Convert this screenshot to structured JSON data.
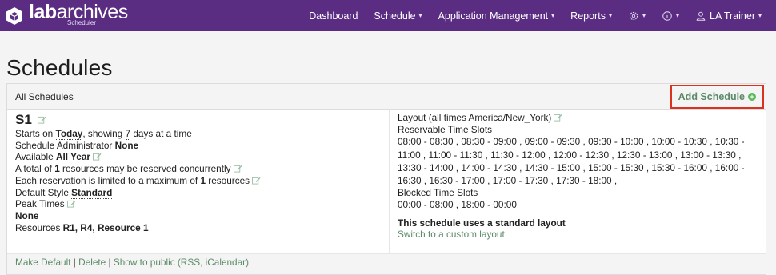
{
  "brand": {
    "name_bold": "lab",
    "name_rest": "archives",
    "subtitle": "Scheduler"
  },
  "nav": {
    "dashboard": "Dashboard",
    "schedule": "Schedule",
    "app_mgmt": "Application Management",
    "reports": "Reports",
    "user": "LA Trainer",
    "caret": "▾"
  },
  "page": {
    "title": "Schedules"
  },
  "panel": {
    "header_label": "All Schedules",
    "add_button": "Add Schedule",
    "add_icon": "+"
  },
  "schedule": {
    "name": "S1",
    "starts_prefix": "Starts on ",
    "starts_value": "Today",
    "showing_prefix": ", showing ",
    "days_value": "7",
    "days_suffix": " days at a time",
    "admin_prefix": "Schedule Administrator ",
    "admin_value": "None",
    "available_prefix": "Available ",
    "available_value": "All Year",
    "concurrent_prefix": "A total of ",
    "concurrent_value": "1",
    "concurrent_suffix": " resources may be reserved concurrently",
    "limit_prefix": "Each reservation is limited to a maximum of ",
    "limit_value": "1",
    "limit_suffix": " resources",
    "style_prefix": "Default Style ",
    "style_value": "Standard",
    "peak_label": "Peak Times",
    "peak_value": "None",
    "resources_prefix": "Resources ",
    "resources_value": "R1, R4, Resource 1"
  },
  "layout": {
    "heading": "Layout (all times America/New_York)",
    "reservable_label": "Reservable Time Slots",
    "reservable_slots": "08:00 - 08:30 , 08:30 - 09:00 , 09:00 - 09:30 , 09:30 - 10:00 , 10:00 - 10:30 , 10:30 - 11:00 , 11:00 - 11:30 , 11:30 - 12:00 , 12:00 - 12:30 , 12:30 - 13:00 , 13:00 - 13:30 , 13:30 - 14:00 , 14:00 - 14:30 , 14:30 - 15:00 , 15:00 - 15:30 , 15:30 - 16:00 , 16:00 - 16:30 , 16:30 - 17:00 , 17:00 - 17:30 , 17:30 - 18:00 ,",
    "blocked_label": "Blocked Time Slots",
    "blocked_slots": "00:00 - 08:00 , 18:00 - 00:00",
    "standard_note": "This schedule uses a standard layout",
    "switch_link": "Switch to a custom layout"
  },
  "footer": {
    "make_default": "Make Default",
    "separator": " | ",
    "delete": "Delete",
    "show_public": "Show to public (RSS, iCalendar)"
  },
  "colors": {
    "navbar": "#5a2d82",
    "link": "#5a8a67",
    "highlight": "#d9331f"
  }
}
